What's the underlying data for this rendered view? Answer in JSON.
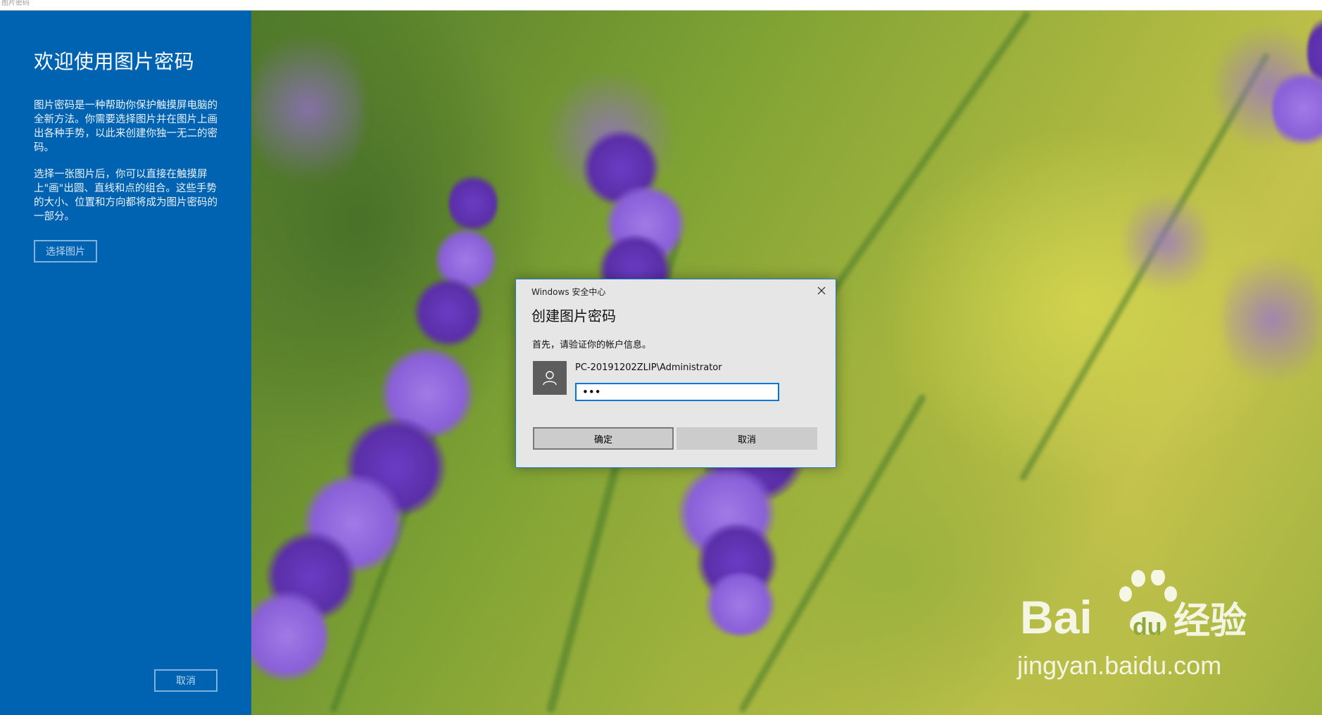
{
  "window": {
    "title": "图片密码"
  },
  "side_panel": {
    "heading": "欢迎使用图片密码",
    "paragraph_1": "图片密码是一种帮助你保护触摸屏电脑的全新方法。你需要选择图片并在图片上画出各种手势，以此来创建你独一无二的密码。",
    "paragraph_2": "选择一张图片后，你可以直接在触摸屏上\"画\"出圆、直线和点的组合。这些手势的大小、位置和方向都将成为图片密码的一部分。",
    "choose_picture_label": "选择图片",
    "cancel_label": "取消"
  },
  "dialog": {
    "caption": "Windows 安全中心",
    "title": "创建图片密码",
    "instruction": "首先，请验证你的帐户信息。",
    "account": "PC-20191202ZLIP\\Administrator",
    "password_value": "abc",
    "ok_label": "确定",
    "cancel_label": "取消"
  },
  "watermark": {
    "brand_latin": "Bai",
    "brand_paw_text": "du",
    "brand_cn": "经验",
    "url": "jingyan.baidu.com"
  },
  "colors": {
    "panel_blue": "#0063b1",
    "dialog_border": "#1979ca",
    "input_focus": "#0078d7",
    "dialog_bg": "#e6e6e6",
    "avatar_bg": "#5d5d5d"
  },
  "icons": {
    "close": "close-icon",
    "avatar": "user-icon"
  }
}
